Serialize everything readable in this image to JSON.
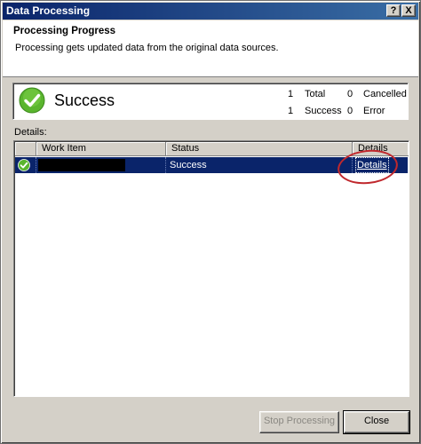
{
  "window": {
    "title": "Data Processing",
    "help_label": "?",
    "close_label": "X"
  },
  "header": {
    "title": "Processing Progress",
    "subtitle": "Processing gets updated data from the original data sources."
  },
  "summary": {
    "status": "Success",
    "stats": [
      {
        "count": "1",
        "label": "Total"
      },
      {
        "count": "0",
        "label": "Cancelled"
      },
      {
        "count": "1",
        "label": "Success"
      },
      {
        "count": "0",
        "label": "Error"
      }
    ]
  },
  "details": {
    "label": "Details:",
    "columns": [
      "Work Item",
      "Status",
      "Details"
    ],
    "rows": [
      {
        "work_item": "",
        "status": "Success",
        "details_link": "Details"
      }
    ]
  },
  "buttons": {
    "stop": "Stop Processing",
    "close": "Close"
  },
  "colors": {
    "selection": "#0a246a",
    "success_green": "#5ab52e",
    "annotation_red": "#c0282d"
  },
  "icons": {
    "summary": "success-check-icon",
    "row": "success-check-icon"
  }
}
